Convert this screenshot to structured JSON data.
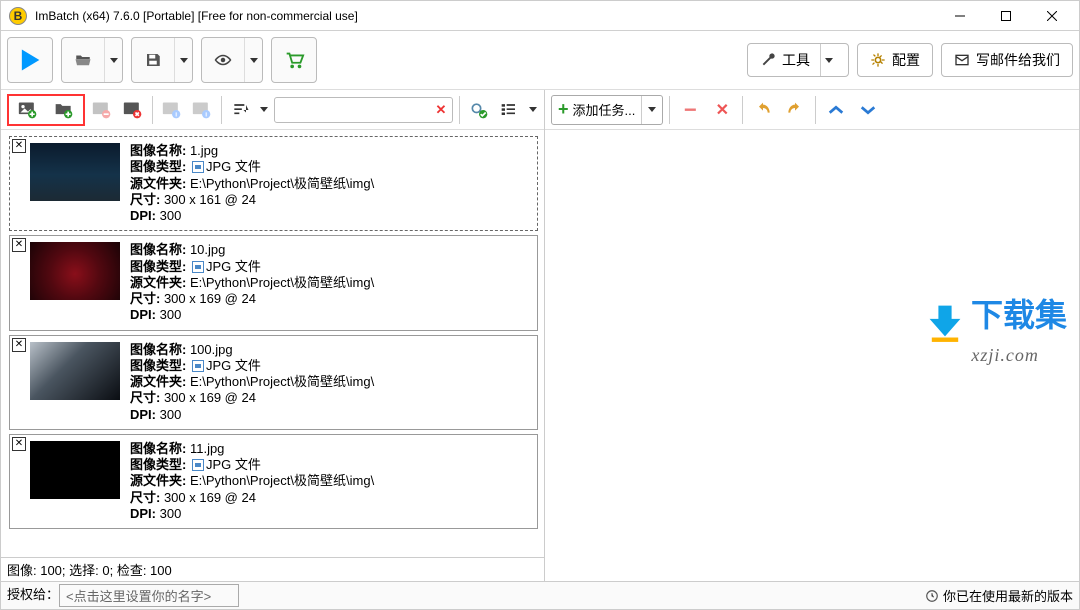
{
  "window": {
    "title": "ImBatch (x64) 7.6.0 [Portable] [Free for non-commercial use]"
  },
  "main_toolbar": {
    "run": "Run",
    "open": "Open",
    "save": "Save",
    "preview": "Preview",
    "store": "Store"
  },
  "top_buttons": {
    "tools": "工具",
    "settings": "配置",
    "email": "写邮件给我们"
  },
  "left_toolbar": {
    "add_file": "Add Images",
    "add_folder": "Add Folder",
    "remove": "Remove",
    "remove_all": "Remove All",
    "rotate_ccw": "Rotate CCW",
    "rotate_cw": "Rotate CW",
    "sort": "Sort",
    "filter_clear": "Clear",
    "check_gear": "Options",
    "list_mode": "List Mode"
  },
  "right_toolbar": {
    "add_task": "添加任务...",
    "minus": "Remove Task",
    "close": "Close Task",
    "undo": "Undo",
    "redo": "Redo",
    "up": "Move Up",
    "down": "Move Down"
  },
  "labels": {
    "name": "图像名称:",
    "type": "图像类型:",
    "folder": "源文件夹:",
    "size": "尺寸:",
    "dpi": "DPI:"
  },
  "images": [
    {
      "name": "1.jpg",
      "type": "JPG 文件",
      "folder": "E:\\Python\\Project\\极简壁纸\\img\\",
      "size": "300 x 161 @ 24",
      "dpi": "300",
      "thumb_style": "background: linear-gradient(180deg,#0b1b2d 0%,#143249 55%,#1c2a34 100%)"
    },
    {
      "name": "10.jpg",
      "type": "JPG 文件",
      "folder": "E:\\Python\\Project\\极简壁纸\\img\\",
      "size": "300 x 169 @ 24",
      "dpi": "300",
      "thumb_style": "background: radial-gradient(circle at 50% 55%, #8a0f1a 0%, #520810 45%, #1a0306 100%)"
    },
    {
      "name": "100.jpg",
      "type": "JPG 文件",
      "folder": "E:\\Python\\Project\\极简壁纸\\img\\",
      "size": "300 x 169 @ 24",
      "dpi": "300",
      "thumb_style": "background: linear-gradient(135deg,#b8c0c8 0%,#4a5560 40%,#0a0d12 100%)"
    },
    {
      "name": "11.jpg",
      "type": "JPG 文件",
      "folder": "E:\\Python\\Project\\极简壁纸\\img\\",
      "size": "300 x 169 @ 24",
      "dpi": "300",
      "thumb_style": "background:#000;"
    }
  ],
  "watermark": {
    "cn": "下载集",
    "en": "xzji.com"
  },
  "status": {
    "counts": "图像: 100; 选择: 0; 检查: 100",
    "license_label": "授权给：",
    "license_placeholder": "<点击这里设置你的名字>",
    "version": "你已在使用最新的版本"
  }
}
